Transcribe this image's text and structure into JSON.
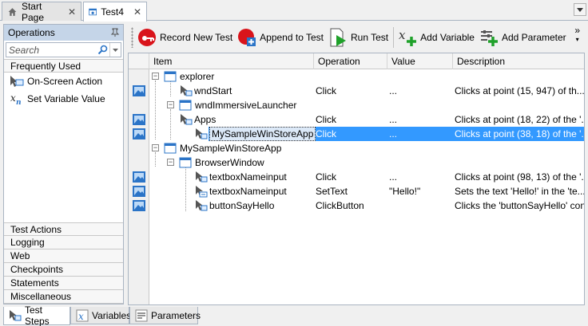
{
  "doc_tabs": [
    {
      "label": "Start Page",
      "icon": "home-icon",
      "active": false
    },
    {
      "label": "Test4",
      "icon": "test-icon",
      "active": true
    }
  ],
  "operations": {
    "title": "Operations",
    "search_placeholder": "Search",
    "top_category": "Frequently Used",
    "items": [
      {
        "label": "On-Screen Action",
        "icon": "on-screen-action-icon"
      },
      {
        "label": "Set Variable Value",
        "icon": "set-variable-icon"
      }
    ],
    "categories": [
      "Test Actions",
      "Logging",
      "Web",
      "Checkpoints",
      "Statements",
      "Miscellaneous"
    ]
  },
  "toolbar": {
    "record_label": "Record New Test",
    "append_label": "Append to Test",
    "run_label": "Run Test",
    "add_variable_label": "Add Variable",
    "add_parameter_label": "Add Parameter"
  },
  "grid": {
    "columns": [
      "Item",
      "Operation",
      "Value",
      "Description"
    ],
    "rows": [
      {
        "item": "explorer",
        "operation": "",
        "value": "",
        "description": "",
        "kind": "window",
        "gutter": false,
        "selected": false
      },
      {
        "item": "wndStart",
        "operation": "Click",
        "value": "...",
        "description": "Clicks at point (15, 947) of th...",
        "kind": "action",
        "gutter": true,
        "selected": false
      },
      {
        "item": "wndImmersiveLauncher",
        "operation": "",
        "value": "",
        "description": "",
        "kind": "window",
        "gutter": false,
        "selected": false
      },
      {
        "item": "Apps",
        "operation": "Click",
        "value": "...",
        "description": "Clicks at point (18, 22) of the '...",
        "kind": "action",
        "gutter": true,
        "selected": false
      },
      {
        "item": "MySampleWinStoreApp",
        "operation": "Click",
        "value": "...",
        "description": "Clicks at point (38, 18) of the '...",
        "kind": "action",
        "gutter": true,
        "selected": true
      },
      {
        "item": "MySampleWinStoreApp",
        "operation": "",
        "value": "",
        "description": "",
        "kind": "window",
        "gutter": false,
        "selected": false
      },
      {
        "item": "BrowserWindow",
        "operation": "",
        "value": "",
        "description": "",
        "kind": "window",
        "gutter": false,
        "selected": false
      },
      {
        "item": "textboxNameinput",
        "operation": "Click",
        "value": "...",
        "description": "Clicks at point (98, 13) of the '...",
        "kind": "action",
        "gutter": true,
        "selected": false
      },
      {
        "item": "textboxNameinput",
        "operation": "SetText",
        "value": "\"Hello!\"",
        "description": "Sets the text 'Hello!' in the 'te...",
        "kind": "action-settext",
        "gutter": true,
        "selected": false
      },
      {
        "item": "buttonSayHello",
        "operation": "ClickButton",
        "value": "",
        "description": "Clicks the 'buttonSayHello' con...",
        "kind": "action",
        "gutter": true,
        "selected": false
      }
    ]
  },
  "bottom_tabs": [
    {
      "label": "Test Steps",
      "icon": "test-steps-icon",
      "active": true
    },
    {
      "label": "Variables",
      "icon": "variables-icon",
      "active": false
    },
    {
      "label": "Parameters",
      "icon": "parameters-icon",
      "active": false
    }
  ],
  "colors": {
    "selection": "#3399ff",
    "panel_header": "#c5d5e8",
    "border": "#a9b4c2"
  }
}
